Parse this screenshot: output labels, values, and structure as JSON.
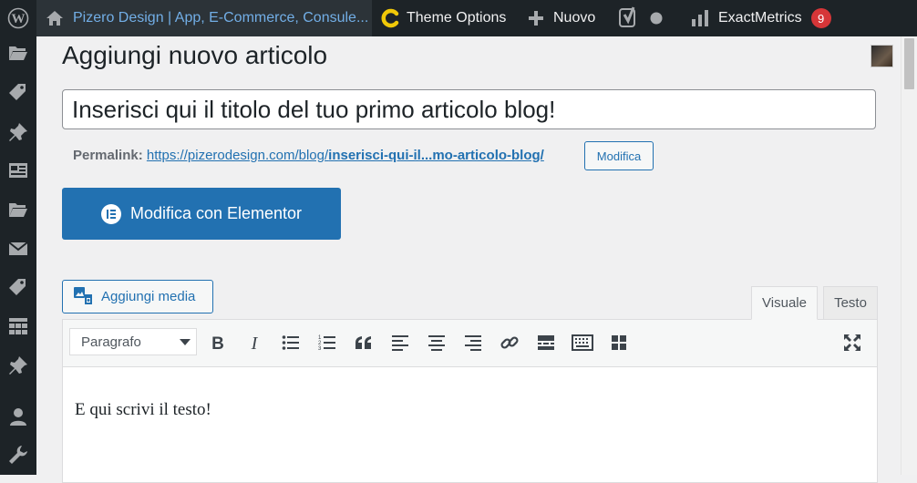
{
  "adminbar": {
    "site_name": "Pizero Design | App, E-Commerce, Consule...",
    "theme_options": "Theme Options",
    "new_label": "Nuovo",
    "exactmetrics": "ExactMetrics",
    "exactmetrics_count": "9"
  },
  "page": {
    "title": "Aggiungi nuovo articolo"
  },
  "post": {
    "title_value": "Inserisci qui il titolo del tuo primo articolo blog!",
    "permalink_label": "Permalink:",
    "permalink_base": "https://pizerodesign.com/blog/",
    "permalink_slug": "inserisci-qui-il...mo-articolo-blog/",
    "permalink_edit": "Modifica",
    "elementor_button": "Modifica con Elementor"
  },
  "editor": {
    "add_media": "Aggiungi media",
    "tab_visual": "Visuale",
    "tab_text": "Testo",
    "format_selected": "Paragrafo",
    "content": "E qui scrivi il testo!"
  },
  "colors": {
    "admin_bg": "#1d2327",
    "accent": "#2271b1",
    "badge": "#d63638",
    "theme_options_icon": "#f0c808"
  }
}
